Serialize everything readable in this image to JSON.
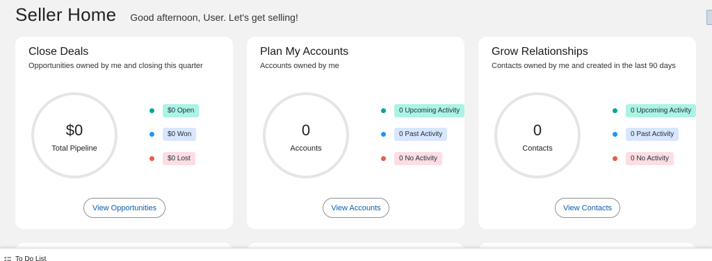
{
  "header": {
    "title": "Seller Home",
    "greeting": "Good afternoon, User. Let's get selling!"
  },
  "cards": [
    {
      "title": "Close Deals",
      "subtitle": "Opportunities owned by me and closing this quarter",
      "ring_value": "$0",
      "ring_label": "Total Pipeline",
      "legend": [
        {
          "label": "$0 Open",
          "dot_color": "#06a59a",
          "pill_bg": "#acf3e4"
        },
        {
          "label": "$0 Won",
          "dot_color": "#1b96ff",
          "pill_bg": "#d8e6fe"
        },
        {
          "label": "$0 Lost",
          "dot_color": "#ea5b4b",
          "pill_bg": "#fddde3"
        }
      ],
      "button_label": "View Opportunities"
    },
    {
      "title": "Plan My Accounts",
      "subtitle": "Accounts owned by me",
      "ring_value": "0",
      "ring_label": "Accounts",
      "legend": [
        {
          "label": "0 Upcoming Activity",
          "dot_color": "#06a59a",
          "pill_bg": "#acf3e4"
        },
        {
          "label": "0 Past Activity",
          "dot_color": "#1b96ff",
          "pill_bg": "#d8e6fe"
        },
        {
          "label": "0 No Activity",
          "dot_color": "#ea5b4b",
          "pill_bg": "#fddde3"
        }
      ],
      "button_label": "View Accounts"
    },
    {
      "title": "Grow Relationships",
      "subtitle": "Contacts owned by me and created in the last 90 days",
      "ring_value": "0",
      "ring_label": "Contacts",
      "legend": [
        {
          "label": "0 Upcoming Activity",
          "dot_color": "#06a59a",
          "pill_bg": "#acf3e4"
        },
        {
          "label": "0 Past Activity",
          "dot_color": "#1b96ff",
          "pill_bg": "#d8e6fe"
        },
        {
          "label": "0 No Activity",
          "dot_color": "#ea5b4b",
          "pill_bg": "#fddde3"
        }
      ],
      "button_label": "View Contacts"
    }
  ],
  "todo": {
    "label": "To Do List",
    "icon": "list-check-icon"
  }
}
